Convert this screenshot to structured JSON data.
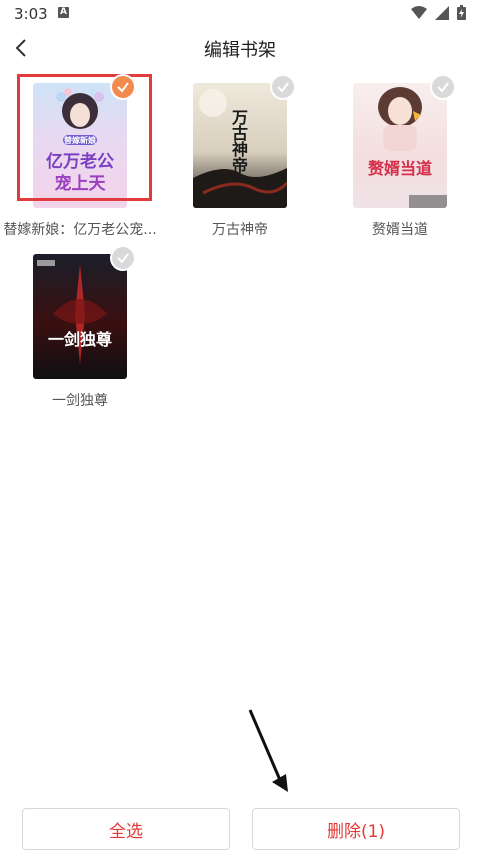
{
  "status": {
    "time": "3:03",
    "notice": "A"
  },
  "header": {
    "title": "编辑书架"
  },
  "books": [
    {
      "title": "替嫁新娘：亿万老公宠...",
      "selected": true,
      "cover_lines": [
        "替嫁新娘",
        "亿万老公",
        "宠上天"
      ]
    },
    {
      "title": "万古神帝",
      "selected": false,
      "cover_lines": [
        "万古神帝"
      ]
    },
    {
      "title": "赘婿当道",
      "selected": false,
      "cover_lines": [
        "赘婿当道"
      ]
    },
    {
      "title": "一剑独尊",
      "selected": false,
      "cover_lines": [
        "一剑独尊"
      ]
    }
  ],
  "footer": {
    "select_all": "全选",
    "delete": "删除(1)"
  },
  "colors": {
    "accent": "#e53935",
    "check_on": "#f28a4d",
    "check_off": "#d9d9d9",
    "frame": "#e33b3b"
  }
}
